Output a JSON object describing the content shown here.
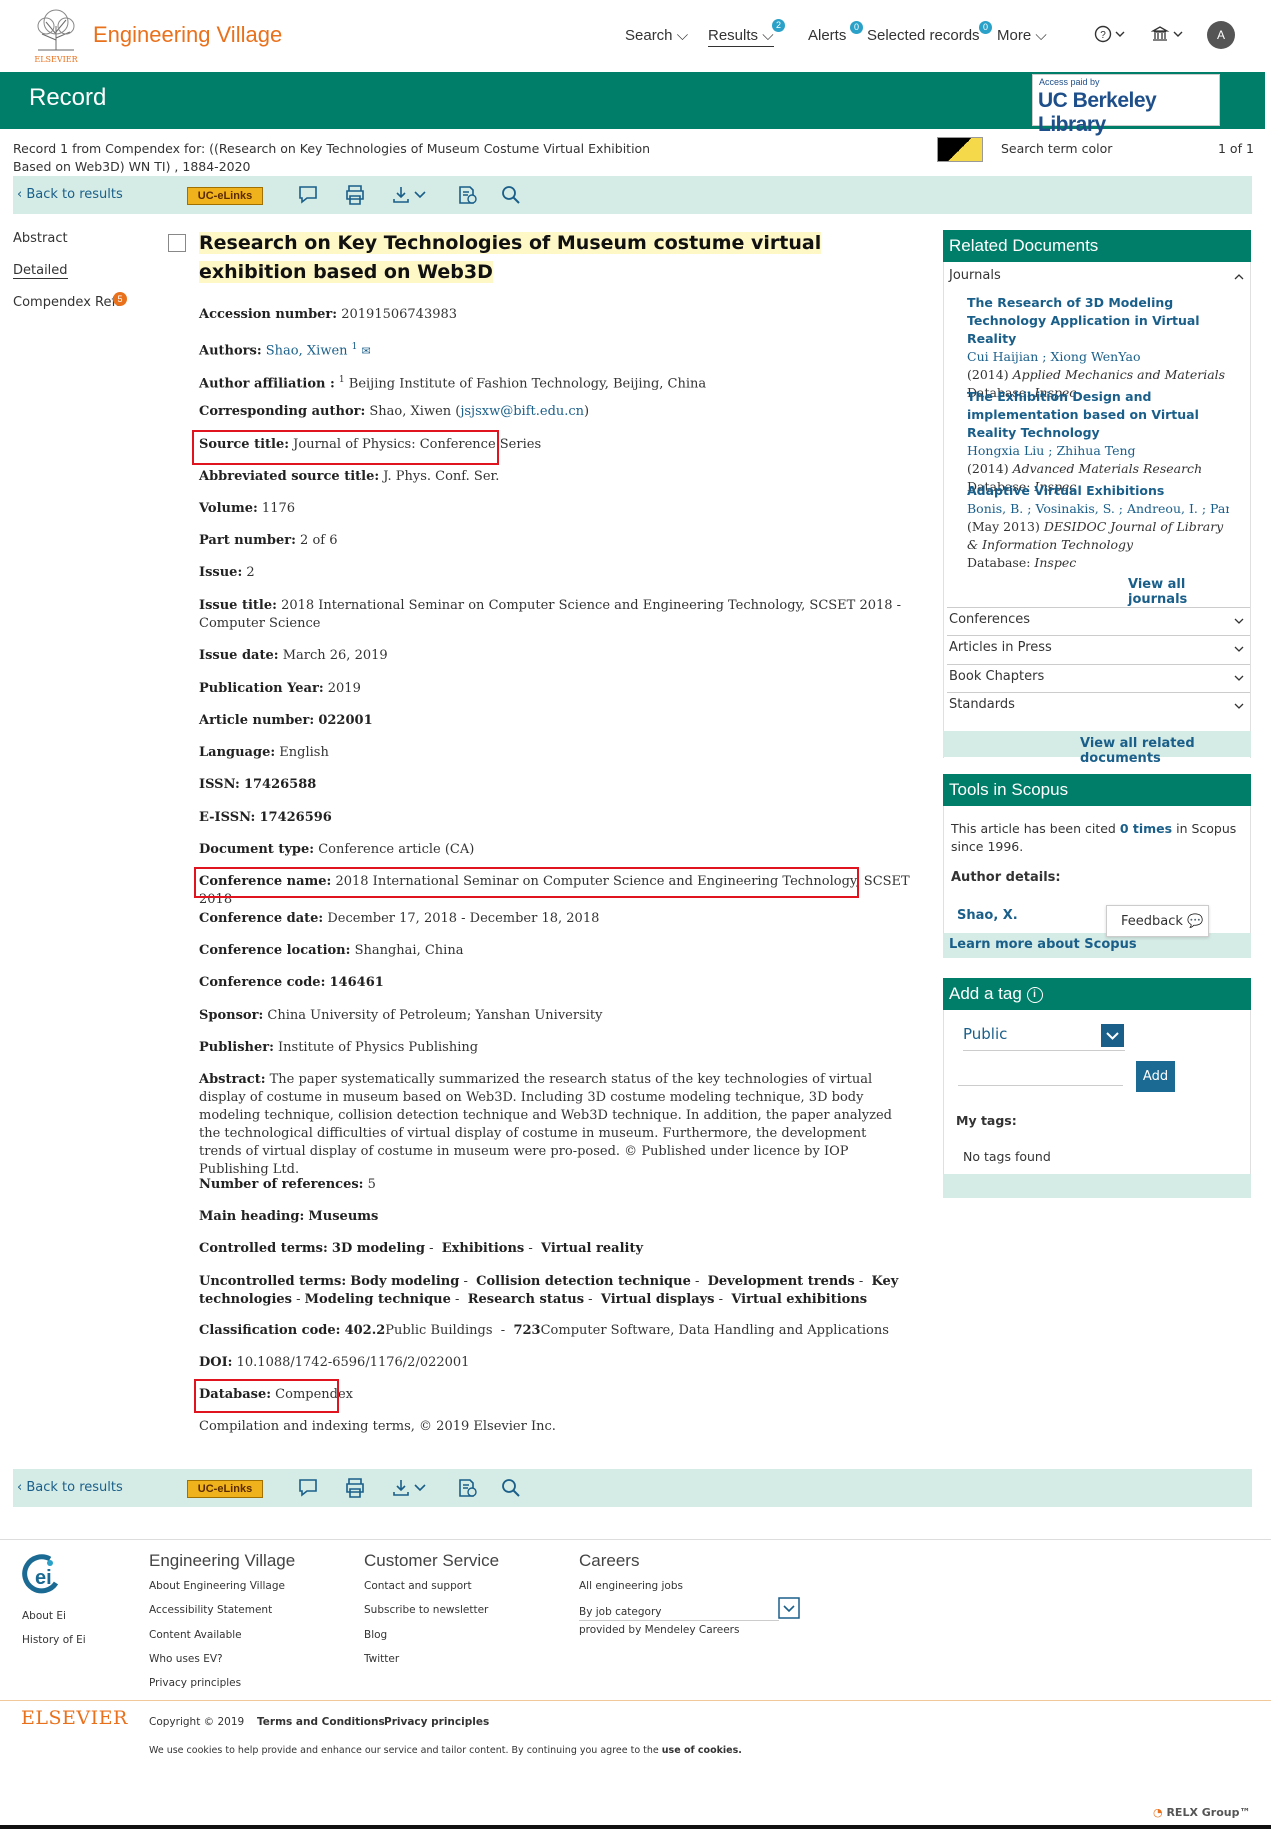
{
  "header": {
    "brand": "Engineering Village",
    "logo_text": "ELSEVIER",
    "nav": {
      "search": "Search",
      "results": "Results",
      "results_badge": "2",
      "alerts": "Alerts",
      "alerts_badge": "0",
      "selected_records": "Selected records",
      "selected_badge": "0",
      "more": "More"
    },
    "avatar_initial": "A"
  },
  "banner": {
    "title": "Record",
    "access_paid": "Access paid by",
    "library": "UC Berkeley Library"
  },
  "search_info": {
    "line1": "Record 1 from Compendex for: ((Research on Key Technologies of Museum Costume Virtual Exhibition",
    "line2": "Based on Web3D) WN TI) , 1884-2020",
    "term_color_label": "Search term color",
    "count": "1 of 1"
  },
  "toolbar": {
    "back": "Back to results",
    "uclinks": "UC-eLinks"
  },
  "leftnav": {
    "abstract": "Abstract",
    "detailed": "Detailed",
    "refs": "Compendex Refs",
    "refs_badge": "5"
  },
  "record": {
    "title": "Research on Key Technologies of Museum costume virtual exhibition based on Web3D",
    "accession": {
      "label": "Accession number:",
      "value": "20191506743983"
    },
    "authors": {
      "label": "Authors:",
      "value": "Shao, Xiwen",
      "sup": "1"
    },
    "affiliation": {
      "label": "Author affiliation :",
      "sup": "1",
      "value": "Beijing Institute of Fashion Technology, Beijing, China"
    },
    "corresponding": {
      "label": "Corresponding author:",
      "value": "Shao, Xiwen",
      "email": "jsjsxw@bift.edu.cn"
    },
    "source_title": {
      "label": "Source title:",
      "value": "Journal of Physics: Conference Series"
    },
    "abbrev_source": {
      "label": "Abbreviated source title:",
      "value": "J. Phys. Conf. Ser."
    },
    "volume": {
      "label": "Volume:",
      "value": "1176"
    },
    "part": {
      "label": "Part number:",
      "value": "2 of 6"
    },
    "issue": {
      "label": "Issue:",
      "value": "2"
    },
    "issue_title": {
      "label": "Issue title:",
      "value": "2018 International Seminar on Computer Science and Engineering Technology, SCSET 2018 - Computer Science"
    },
    "issue_date": {
      "label": "Issue date:",
      "value": "March 26, 2019"
    },
    "pub_year": {
      "label": "Publication Year:",
      "value": "2019"
    },
    "article_number": {
      "label": "Article number:",
      "value": "022001"
    },
    "language": {
      "label": "Language:",
      "value": "English"
    },
    "issn": {
      "label": "ISSN:",
      "value": "17426588"
    },
    "eissn": {
      "label": "E-ISSN:",
      "value": "17426596"
    },
    "doc_type": {
      "label": "Document type:",
      "value": "Conference article (CA)"
    },
    "conf_name": {
      "label": "Conference name:",
      "value": "2018 International Seminar on Computer Science and Engineering Technology, SCSET 2018"
    },
    "conf_date": {
      "label": "Conference date:",
      "value": "December 17, 2018 - December 18, 2018"
    },
    "conf_location": {
      "label": "Conference location:",
      "value": "Shanghai, China"
    },
    "conf_code": {
      "label": "Conference code:",
      "value": "146461"
    },
    "sponsor": {
      "label": "Sponsor:",
      "value": "China University of Petroleum; Yanshan University"
    },
    "publisher": {
      "label": "Publisher:",
      "value": "Institute of Physics Publishing"
    },
    "abstract": {
      "label": "Abstract:",
      "value": "The paper systematically summarized the research status of the key technologies of virtual display of costume in museum based on Web3D. Including 3D costume modeling technique, 3D body modeling technique, collision detection technique and Web3D technique. In addition, the paper analyzed the technological difficulties of virtual display of costume in museum. Furthermore, the development trends of virtual display of costume in museum were pro-posed. © Published under licence by IOP Publishing Ltd."
    },
    "num_refs": {
      "label": "Number of references:",
      "value": "5"
    },
    "main_heading": {
      "label": "Main heading:",
      "value": "Museums"
    },
    "controlled": {
      "label": "Controlled terms:",
      "terms": [
        "3D modeling",
        "Exhibitions",
        "Virtual reality"
      ]
    },
    "uncontrolled": {
      "label": "Uncontrolled terms:",
      "terms": [
        "Body modeling",
        "Collision detection technique",
        "Development trends",
        "Key technologies",
        "Modeling technique",
        "Research status",
        "Virtual displays",
        "Virtual exhibitions"
      ]
    },
    "classification": {
      "label": "Classification code:",
      "code1": "402.2",
      "text1": "Public Buildings",
      "code2": "723",
      "text2": "Computer Software, Data Handling and Applications"
    },
    "doi": {
      "label": "DOI:",
      "value": "10.1088/1742-6596/1176/2/022001"
    },
    "database": {
      "label": "Database:",
      "value": "Compendex"
    },
    "copyright": "Compilation and indexing terms, © 2019 Elsevier Inc."
  },
  "related": {
    "heading": "Related Documents",
    "journals": "Journals",
    "items": [
      {
        "title": "The Research of 3D Modeling Technology Application in Virtual Reality",
        "authors": [
          "Cui Haijian",
          "Xiong WenYao"
        ],
        "year": "(2014)",
        "source": "Applied Mechanics and Materials",
        "db_label": "Database:",
        "db": "Inspec"
      },
      {
        "title": "The Exhibition Design and implementation based on Virtual Reality Technology",
        "authors": [
          "Hongxia Liu",
          "Zhihua Teng"
        ],
        "year": "(2014)",
        "source": "Advanced Materials Research",
        "db_label": "Database:",
        "db": "Inspec"
      },
      {
        "title": "Adaptive Virtual Exhibitions",
        "authors": [
          "Bonis, B.",
          "Vosinakis, S.",
          "Andreou, I.",
          "Pan..."
        ],
        "year": "(May 2013)",
        "source": "DESIDOC Journal of Library & Information Technology",
        "db_label": "Database:",
        "db": "Inspec"
      }
    ],
    "view_all_journals": "View all journals",
    "sections": [
      "Conferences",
      "Articles in Press",
      "Book Chapters",
      "Standards"
    ],
    "view_all_related": "View all related documents"
  },
  "scopus": {
    "heading": "Tools in Scopus",
    "cited_pre": "This article has been cited",
    "cited_link": "0 times",
    "cited_post": "in Scopus since 1996.",
    "author_details": "Author details:",
    "author": "Shao, X.",
    "learn_more": "Learn more about Scopus",
    "feedback": "Feedback"
  },
  "tags": {
    "heading": "Add a tag",
    "visibility": "Public",
    "add": "Add",
    "my_tags": "My tags:",
    "none": "No tags found"
  },
  "footer": {
    "col1": {
      "about": "About Ei",
      "history": "History of Ei"
    },
    "ev": {
      "heading": "Engineering Village",
      "links": [
        "About Engineering Village",
        "Accessibility Statement",
        "Content Available",
        "Who uses EV?",
        "Privacy principles"
      ]
    },
    "cs": {
      "heading": "Customer Service",
      "links": [
        "Contact and support",
        "Subscribe to newsletter",
        "Blog",
        "Twitter"
      ]
    },
    "careers": {
      "heading": "Careers",
      "all_jobs": "All engineering jobs",
      "by_category": "By job category",
      "provided": "provided by Mendeley Careers"
    },
    "elsevier": "ELSEVIER",
    "copyright": "Copyright © 2019",
    "terms": "Terms and Conditions",
    "privacy": "Privacy principles",
    "cookies_pre": "We use cookies to help provide and enhance our service and tailor content. By continuing you agree to the",
    "cookies_link": "use of cookies.",
    "relx": "RELX Group™"
  }
}
